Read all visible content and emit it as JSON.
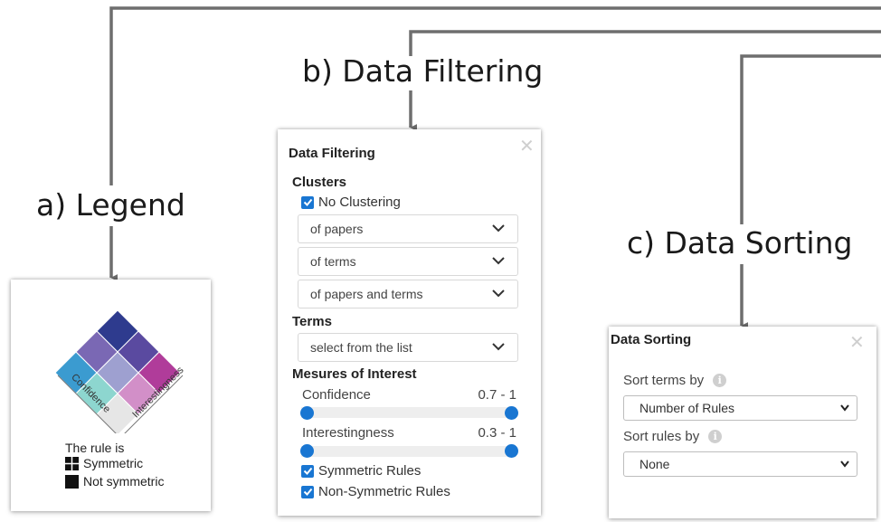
{
  "labels": {
    "legend": "a) Legend",
    "filtering": "b) Data Filtering",
    "sorting": "c) Data Sorting"
  },
  "colors": {
    "accent": "#1976d2",
    "connector": "#6e6e6e",
    "legend_grid": [
      [
        "#2e3b8e",
        "#5a4aa0",
        "#b03c9a"
      ],
      [
        "#7a68b4",
        "#9ea0d0",
        "#d28fc8"
      ],
      [
        "#3b9bd0",
        "#8dd6cf",
        "#e6e6e6"
      ]
    ]
  },
  "legend": {
    "axis_confidence": "Confidence",
    "axis_interestingness": "Interestingness",
    "rule_is": "The rule is",
    "symmetric": "Symmetric",
    "not_symmetric": "Not symmetric"
  },
  "filtering": {
    "title": "Data Filtering",
    "close_icon": "close-icon",
    "clusters_title": "Clusters",
    "no_clustering_label": "No Clustering",
    "no_clustering_checked": true,
    "cluster_options": [
      "of papers",
      "of terms",
      "of papers and terms"
    ],
    "terms_title": "Terms",
    "terms_placeholder": "select from the list",
    "measures_title": "Mesures of Interest",
    "confidence": {
      "label": "Confidence",
      "range": "0.7 - 1",
      "min": 0.7,
      "max": 1
    },
    "interestingness": {
      "label": "Interestingness",
      "range": "0.3 - 1",
      "min": 0.3,
      "max": 1
    },
    "symmetric_rules": {
      "label": "Symmetric Rules",
      "checked": true
    },
    "non_symmetric_rules": {
      "label": "Non-Symmetric Rules",
      "checked": true
    }
  },
  "sorting": {
    "title": "Data Sorting",
    "close_icon": "close-icon",
    "sort_terms_label": "Sort terms by",
    "sort_terms_value": "Number of Rules",
    "sort_rules_label": "Sort rules by",
    "sort_rules_value": "None",
    "info_icon": "info-icon"
  }
}
